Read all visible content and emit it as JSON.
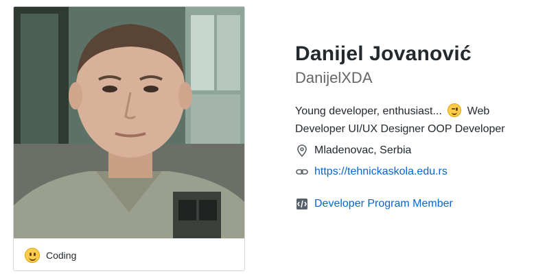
{
  "profile": {
    "name": "Danijel Jovanović",
    "username": "DanijelXDA",
    "bio_part1": "Young developer, enthusiast...",
    "bio_part2": "Web Developer UI/UX Designer OOP Developer",
    "location": "Mladenovac, Serbia",
    "website": "https://tehnickaskola.edu.rs",
    "program_badge": "Developer Program Member"
  },
  "status": {
    "emoji": "slightly-smiling-face",
    "text": "Coding"
  },
  "icons": {
    "location": "location-pin-icon",
    "website": "link-icon",
    "badge": "developer-program-icon"
  },
  "colors": {
    "link": "#0366d6",
    "text": "#24292e",
    "muted": "#666666"
  }
}
